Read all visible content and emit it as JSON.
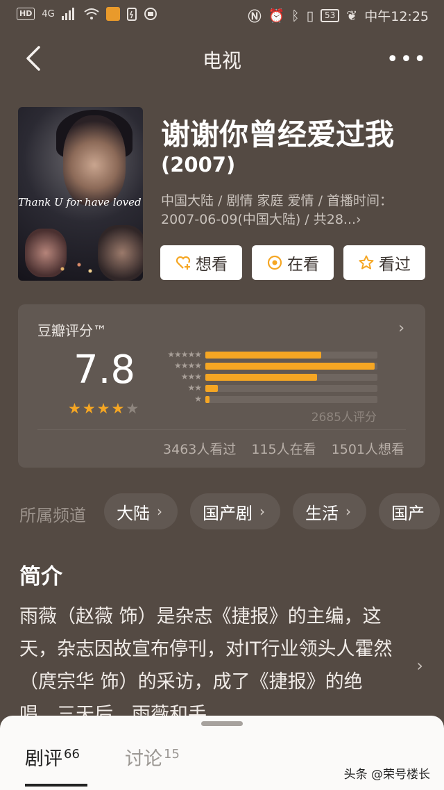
{
  "status_bar": {
    "left": [
      "HD",
      "4G"
    ],
    "battery": "53",
    "time": "中午12:25"
  },
  "nav": {
    "title": "电视"
  },
  "movie": {
    "title": "谢谢你曾经爱过我",
    "year": "(2007)",
    "poster_text": "Thank U for have loved m",
    "meta": "中国大陆 / 剧情 家庭 爱情 / 首播时间：2007-06-09(中国大陆) / 共28...›"
  },
  "actions": [
    {
      "label": "想看",
      "icon": "heart-plus-icon"
    },
    {
      "label": "在看",
      "icon": "target-icon"
    },
    {
      "label": "看过",
      "icon": "star-outline-icon"
    }
  ],
  "rating": {
    "label": "豆瓣评分™",
    "score": "7.8",
    "stars": 4,
    "distribution": [
      {
        "stars": "★★★★★",
        "percent": 28
      },
      {
        "stars": "★★★★",
        "percent": 41
      },
      {
        "stars": "★★★",
        "percent": 27
      },
      {
        "stars": "★★",
        "percent": 3
      },
      {
        "stars": "★",
        "percent": 1
      }
    ],
    "count": "2685人评分",
    "watched": "3463人看过",
    "watching": "115人在看",
    "want": "1501人想看"
  },
  "channels": {
    "label": "所属频道",
    "items": [
      "大陆",
      "国产剧",
      "生活",
      "国产"
    ]
  },
  "intro": {
    "heading": "简介",
    "text": "雨薇（赵薇 饰）是杂志《捷报》的主编，这天，杂志因故宣布停刊，对IT行业领头人霍然（庹宗华 饰）的采访，成了《捷报》的绝唱。三天后，雨薇和手"
  },
  "sheet": {
    "tabs": [
      {
        "label": "剧评",
        "count": "66"
      },
      {
        "label": "讨论",
        "count": "15"
      }
    ],
    "watermark": "头条 @荣号楼长"
  },
  "colors": {
    "accent": "#f5a623",
    "background": "#544a43",
    "card": "#615852"
  }
}
